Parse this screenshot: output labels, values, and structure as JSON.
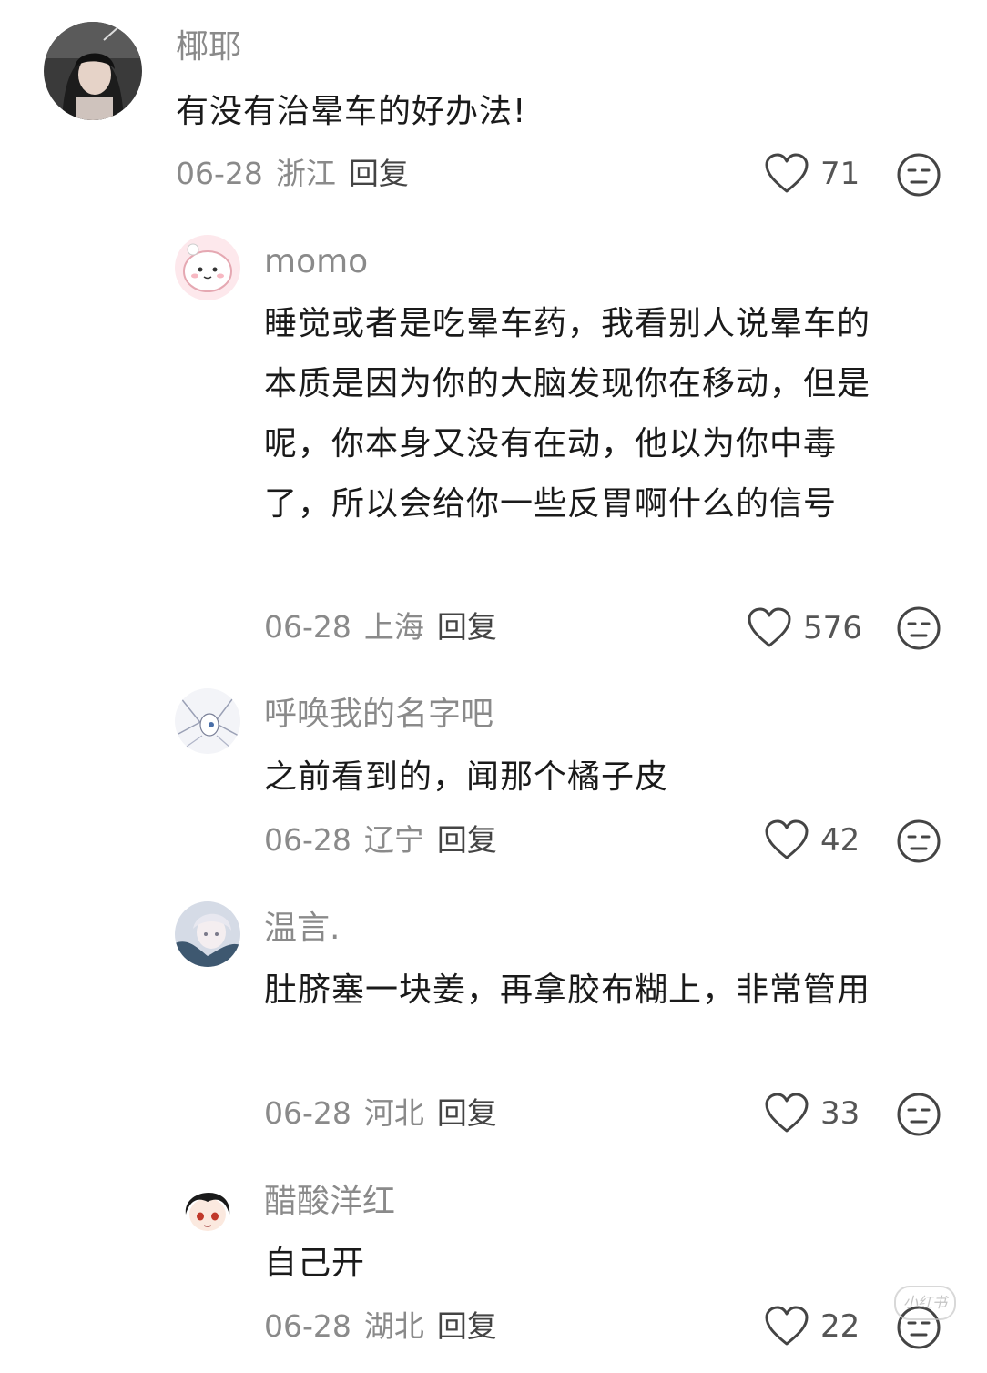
{
  "comments": [
    {
      "username": "椰耶",
      "text": "有没有治晕车的好办法!",
      "date": "06-28",
      "location": "浙江",
      "reply_label": "回复",
      "likes": "71",
      "avatar_icon": "user-photo-avatar"
    },
    {
      "username": "momo",
      "text": "睡觉或者是吃晕车药，我看别人说晕车的本质是因为你的大脑发现你在移动，但是呢，你本身又没有在动，他以为你中毒了，所以会给你一些反胃啊什么的信号",
      "date": "06-28",
      "location": "上海",
      "reply_label": "回复",
      "likes": "576",
      "avatar_icon": "cartoon-pink-avatar"
    },
    {
      "username": "呼唤我的名字吧",
      "text": "之前看到的，闻那个橘子皮",
      "date": "06-28",
      "location": "辽宁",
      "reply_label": "回复",
      "likes": "42",
      "avatar_icon": "anime-sketch-avatar"
    },
    {
      "username": "温言.",
      "text": "肚脐塞一块姜，再拿胶布糊上，非常管用",
      "date": "06-28",
      "location": "河北",
      "reply_label": "回复",
      "likes": "33",
      "avatar_icon": "anime-girl-avatar"
    },
    {
      "username": "醋酸洋红",
      "text": "自己开",
      "date": "06-28",
      "location": "湖北",
      "reply_label": "回复",
      "likes": "22",
      "avatar_icon": "chibi-boy-avatar"
    }
  ],
  "watermark": "小红书"
}
